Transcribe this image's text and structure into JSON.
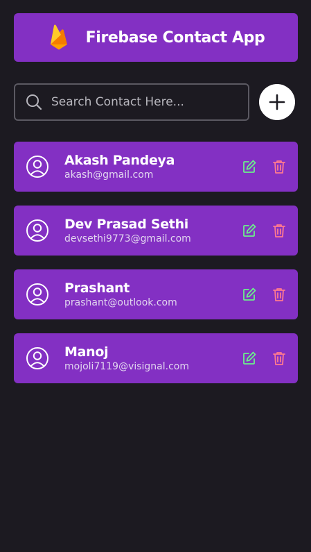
{
  "header": {
    "title": "Firebase Contact App",
    "logo_icon": "firebase-logo"
  },
  "search": {
    "placeholder": "Search Contact Here...",
    "value": "",
    "icon": "search-icon"
  },
  "add_button": {
    "icon": "plus-icon"
  },
  "contacts": [
    {
      "name": "Akash Pandeya",
      "email": "akash@gmail.com"
    },
    {
      "name": "Dev Prasad Sethi",
      "email": "devsethi9773@gmail.com"
    },
    {
      "name": "Prashant",
      "email": "prashant@outlook.com"
    },
    {
      "name": "Manoj",
      "email": "mojoli7119@visignal.com"
    }
  ],
  "colors": {
    "background": "#1c1a21",
    "card": "#8330c3",
    "edit_icon": "#6bf08b",
    "delete_icon": "#ff7a8f"
  }
}
